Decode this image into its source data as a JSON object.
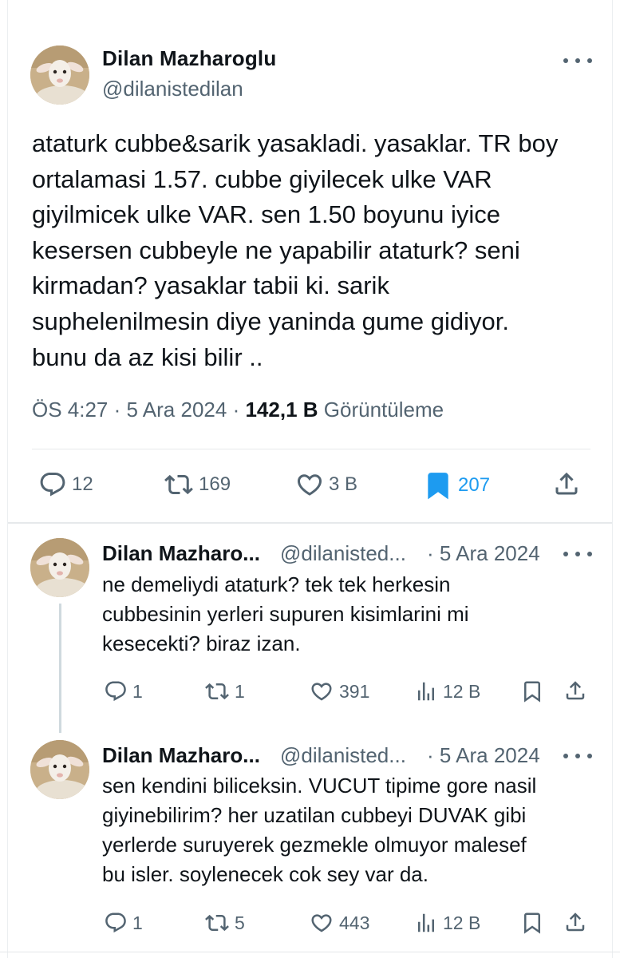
{
  "main_tweet": {
    "author_name": "Dilan Mazharoglu",
    "author_handle": "@dilanistedilan",
    "text_lines": [
      "ataturk cubbe&sarik yasakladi. yasaklar. TR boy",
      "ortalamasi 1.57. cubbe giyilecek ulke VAR",
      "giyilmicek ulke VAR. sen 1.50 boyunu iyice",
      "kesersen cubbeyle ne yapabilir ataturk? seni",
      "kirmadan? yasaklar tabii ki. sarik",
      "suphelenilmesin diye yaninda gume gidiyor.",
      "bunu da az kisi bilir .."
    ],
    "time": "ÖS 4:27",
    "separator": "·",
    "date": "5 Ara 2024",
    "views_count": "142,1 B",
    "views_label": "Görüntüleme",
    "replies": "12",
    "reposts": "169",
    "likes": "3 B",
    "bookmarks": "207"
  },
  "replies": [
    {
      "author_name": "Dilan Mazharo...",
      "author_handle": "@dilanisted...",
      "date": "· 5 Ara 2024",
      "text_lines": [
        "ne demeliydi ataturk? tek tek herkesin",
        "cubbesinin yerleri supuren kisimlarini mi",
        "kesecekti? biraz izan."
      ],
      "replies": "1",
      "reposts": "1",
      "likes": "391",
      "views": "12 B"
    },
    {
      "author_name": "Dilan Mazharo...",
      "author_handle": "@dilanisted...",
      "date": "· 5 Ara 2024",
      "text_lines": [
        "sen kendini biliceksin. VUCUT tipime gore nasil",
        "giyinebilirim? her uzatilan cubbeyi DUVAK gibi",
        "yerlerde suruyerek gezmekle olmuyor malesef",
        "bu isler. soylenecek cok sey var da."
      ],
      "replies": "1",
      "reposts": "5",
      "likes": "443",
      "views": "12 B"
    }
  ],
  "colors": {
    "text_primary": "#0f1419",
    "text_secondary": "#536471",
    "accent_bookmark": "#1d9bf0",
    "divider": "#e6e9eb"
  },
  "icons": {
    "reply": "reply-icon",
    "repost": "repost-icon",
    "like": "heart-icon",
    "bookmark": "bookmark-icon",
    "share": "share-icon",
    "views": "analytics-icon",
    "more": "more-icon"
  }
}
